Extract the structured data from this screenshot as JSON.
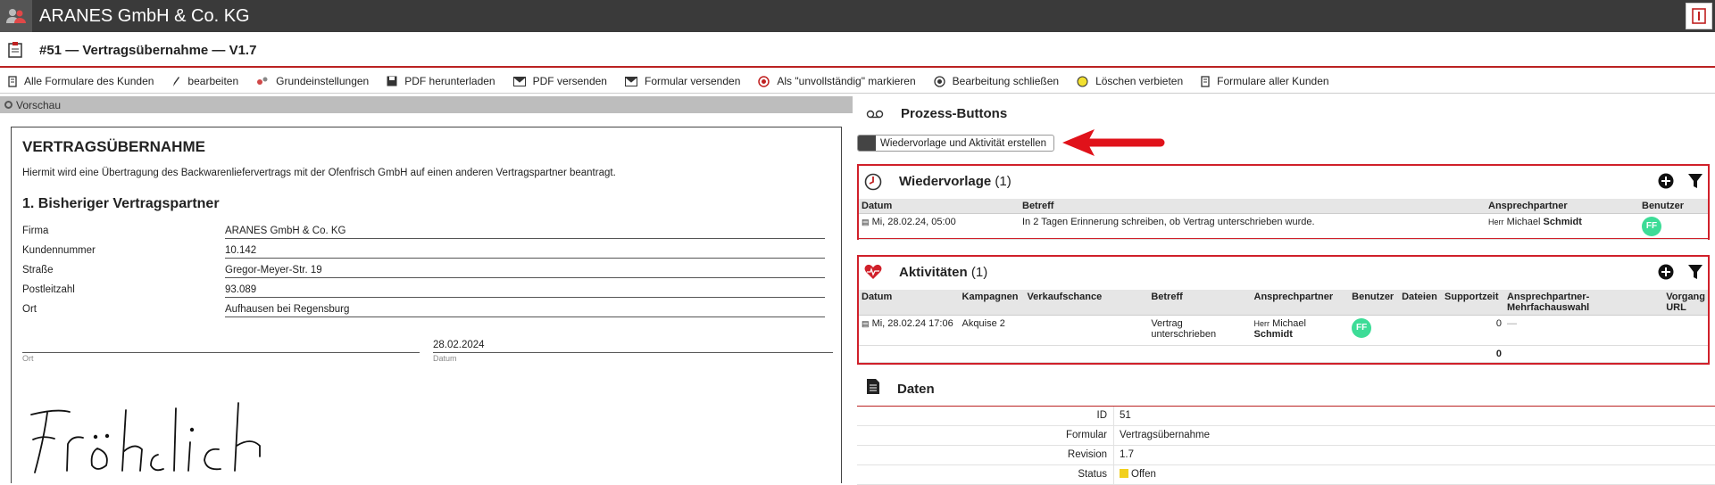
{
  "app": {
    "title": "ARANES GmbH & Co. KG"
  },
  "form": {
    "title": "#51 — Vertragsübernahme — V1.7"
  },
  "toolbar": [
    {
      "label": "Alle Formulare des Kunden",
      "icon": "document-icon"
    },
    {
      "label": "bearbeiten",
      "icon": "pencil-icon"
    },
    {
      "label": "Grundeinstellungen",
      "icon": "settings-icon"
    },
    {
      "label": "PDF herunterladen",
      "icon": "floppy-icon"
    },
    {
      "label": "PDF versenden",
      "icon": "envelope-icon"
    },
    {
      "label": "Formular versenden",
      "icon": "envelope-icon"
    },
    {
      "label": "Als \"unvollständig\" markieren",
      "icon": "target-icon"
    },
    {
      "label": "Bearbeitung schließen",
      "icon": "radio-icon"
    },
    {
      "label": "Löschen verbieten",
      "icon": "yellow-circle-icon"
    },
    {
      "label": "Formulare aller Kunden",
      "icon": "document-icon"
    }
  ],
  "preview": {
    "label": "Vorschau",
    "heading": "VERTRAGSÜBERNAHME",
    "intro": "Hiermit wird eine Übertragung des Backwarenliefervertrags mit der Ofenfrisch GmbH auf einen anderen Vertragspartner beantragt.",
    "section": "1. Bisheriger Vertragspartner",
    "fields": [
      {
        "label": "Firma",
        "value": "ARANES GmbH & Co. KG"
      },
      {
        "label": "Kundennummer",
        "value": "10.142"
      },
      {
        "label": "Straße",
        "value": "Gregor-Meyer-Str. 19"
      },
      {
        "label": "Postleitzahl",
        "value": "93.089"
      },
      {
        "label": "Ort",
        "value": "Aufhausen bei Regensburg"
      }
    ],
    "sign_date": "28.02.2024",
    "sign_ort_label": "Ort",
    "sign_datum_label": "Datum",
    "signature": "Fröhlich"
  },
  "process": {
    "title": "Prozess-Buttons",
    "button": "Wiedervorlage und Aktivität erstellen"
  },
  "wiedervorlage": {
    "title": "Wiedervorlage",
    "count": "(1)",
    "columns": [
      "Datum",
      "Betreff",
      "Ansprechpartner",
      "Benutzer"
    ],
    "rows": [
      {
        "datum": "Mi, 28.02.24, 05:00",
        "betreff": "In 2 Tagen Erinnerung schreiben, ob Vertrag unterschrieben wurde.",
        "anrede": "Herr",
        "vorname": "Michael",
        "nachname": "Schmidt",
        "benutzer": "FF"
      }
    ]
  },
  "aktivitaeten": {
    "title": "Aktivitäten",
    "count": "(1)",
    "columns": [
      "Datum",
      "Kampagnen",
      "Verkaufschance",
      "Betreff",
      "Ansprechpartner",
      "Benutzer",
      "Dateien",
      "Supportzeit",
      "Ansprechpartner-Mehrfachauswahl",
      "Vorgang URL"
    ],
    "rows": [
      {
        "datum": "Mi, 28.02.24 17:06",
        "kampagne": "Akquise 2",
        "verkaufschance": "",
        "betreff": "Vertrag unterschrieben",
        "anrede": "Herr",
        "vorname": "Michael",
        "nachname": "Schmidt",
        "benutzer": "FF",
        "dateien": "",
        "supportzeit": "0",
        "mehrfach": "—",
        "url": ""
      }
    ],
    "total": "0"
  },
  "daten": {
    "title": "Daten",
    "rows": [
      {
        "key": "ID",
        "value": "51"
      },
      {
        "key": "Formular",
        "value": "Vertragsübernahme"
      },
      {
        "key": "Revision",
        "value": "1.7"
      },
      {
        "key": "Status",
        "value": "Offen"
      }
    ]
  },
  "colors": {
    "accent_red": "#d0202a",
    "topbar": "#3a3a3a",
    "avatar_green": "#3ddc97",
    "status_yellow": "#f2d01c"
  }
}
